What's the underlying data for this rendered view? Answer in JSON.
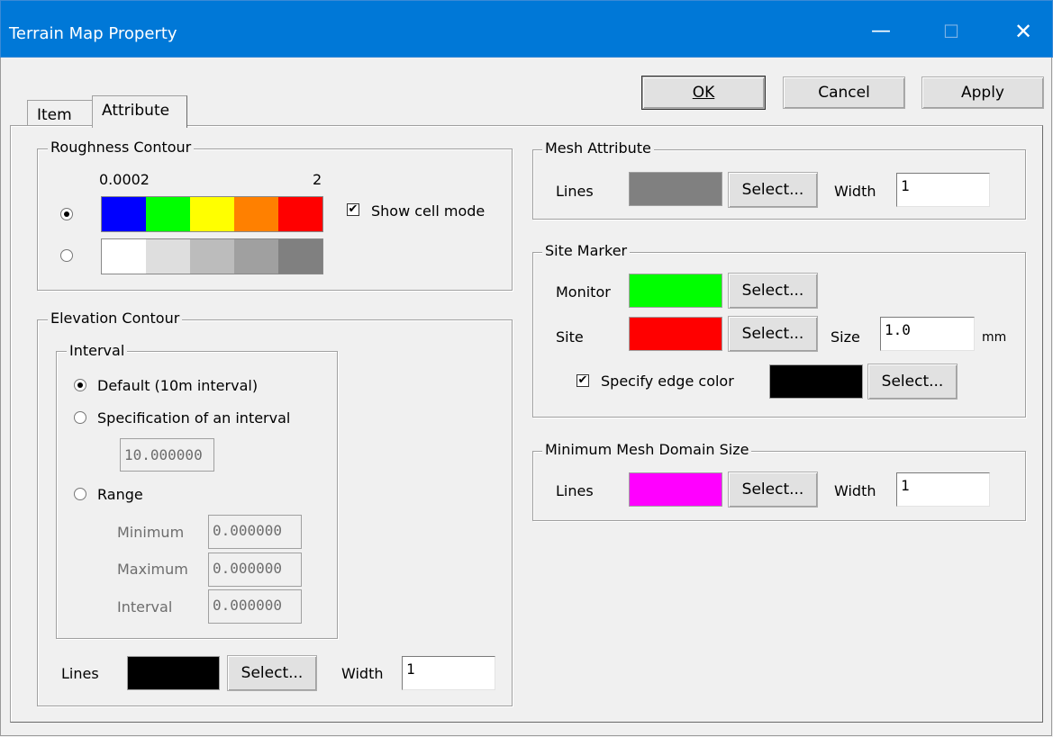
{
  "window": {
    "title": "Terrain Map Property",
    "minimize_glyph": "—",
    "maximize_glyph": "☐",
    "close_glyph": "✕"
  },
  "buttons": {
    "ok": "OK",
    "cancel": "Cancel",
    "apply": "Apply"
  },
  "tabs": [
    {
      "label": "Item",
      "selected": false
    },
    {
      "label": "Attribute",
      "selected": true
    }
  ],
  "roughness": {
    "title": "Roughness Contour",
    "min_label": "0.0002",
    "max_label": "2",
    "color_scale": [
      "#0000ff",
      "#00ff00",
      "#ffff00",
      "#ff8000",
      "#ff0000"
    ],
    "gray_scale": [
      "#ffffff",
      "#dedede",
      "#bcbcbc",
      "#a0a0a0",
      "#808080"
    ],
    "selected": "color",
    "show_cell_mode_label": "Show cell mode",
    "show_cell_mode": true
  },
  "elevation": {
    "title": "Elevation Contour",
    "interval_title": "Interval",
    "default_label": "Default (10m interval)",
    "spec_label": "Specification of an interval",
    "spec_value": "10.000000",
    "range_label": "Range",
    "minimum_label": "Minimum",
    "maximum_label": "Maximum",
    "interval_label": "Interval",
    "minimum_value": "0.000000",
    "maximum_value": "0.000000",
    "interval_value": "0.000000",
    "lines_label": "Lines",
    "lines_color": "#000000",
    "select_label": "Select...",
    "width_label": "Width",
    "width_value": "1"
  },
  "mesh": {
    "title": "Mesh Attribute",
    "lines_label": "Lines",
    "lines_color": "#808080",
    "select_label": "Select...",
    "width_label": "Width",
    "width_value": "1"
  },
  "site_marker": {
    "title": "Site Marker",
    "monitor_label": "Monitor",
    "monitor_color": "#00ff00",
    "site_label": "Site",
    "site_color": "#ff0000",
    "select_label": "Select...",
    "size_label": "Size",
    "size_value": "1.0",
    "unit": "mm",
    "edge_label": "Specify edge color",
    "edge_checked": true,
    "edge_color": "#000000"
  },
  "min_mesh": {
    "title": "Minimum Mesh Domain Size",
    "lines_label": "Lines",
    "lines_color": "#ff00ff",
    "select_label": "Select...",
    "width_label": "Width",
    "width_value": "1"
  }
}
